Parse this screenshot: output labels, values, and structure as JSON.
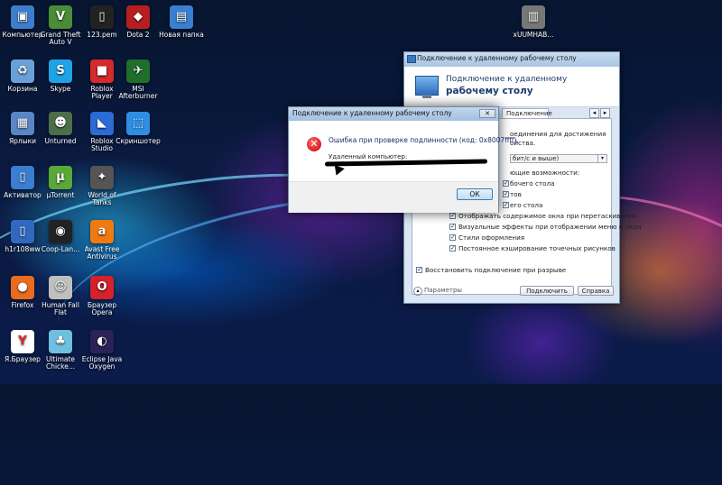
{
  "desktop": {
    "icons": [
      {
        "label": "Компьютер",
        "icon": "computer-icon",
        "color": "#3d7ecb"
      },
      {
        "label": "Grand Theft Auto V",
        "icon": "gta-icon",
        "color": "#4a8c3a"
      },
      {
        "label": "123.pem",
        "icon": "file-icon",
        "color": "#222222"
      },
      {
        "label": "Dota 2",
        "icon": "dota-icon",
        "color": "#b51f1f"
      },
      {
        "label": "Новая папка",
        "icon": "folder-icon",
        "color": "#3a7fd0"
      },
      {
        "label": "Корзина",
        "icon": "recycle-bin-icon",
        "color": "#6aa0d8"
      },
      {
        "label": "Skype",
        "icon": "skype-icon",
        "color": "#1fa3e6"
      },
      {
        "label": "Roblox Player",
        "icon": "roblox-icon",
        "color": "#d42a2a"
      },
      {
        "label": "MSI Afterburner",
        "icon": "msi-icon",
        "color": "#1f6e2c"
      },
      {
        "label": "Ярлыки",
        "icon": "shortcuts-icon",
        "color": "#5a86c5"
      },
      {
        "label": "Unturned",
        "icon": "unturned-icon",
        "color": "#4c6f4a"
      },
      {
        "label": "Roblox Studio",
        "icon": "roblox-studio-icon",
        "color": "#2a6bd4"
      },
      {
        "label": "Скриншотер",
        "icon": "screenshot-icon",
        "color": "#2f8de4"
      },
      {
        "label": "Активатор",
        "icon": "activator-icon",
        "color": "#3b7dd0"
      },
      {
        "label": "µTorrent",
        "icon": "utorrent-icon",
        "color": "#5aa83a"
      },
      {
        "label": "World of Tanks",
        "icon": "wot-icon",
        "color": "#555555"
      },
      {
        "label": "h1r108ww",
        "icon": "file-icon",
        "color": "#2f6ac0"
      },
      {
        "label": "Coop-Lan...",
        "icon": "cooplan-icon",
        "color": "#222222"
      },
      {
        "label": "Avast Free Antivirus",
        "icon": "avast-icon",
        "color": "#f07a12"
      },
      {
        "label": "Firefox",
        "icon": "firefox-icon",
        "color": "#e86b1f"
      },
      {
        "label": "Human Fall Flat",
        "icon": "humanfallflat-icon",
        "color": "#bfbfbf"
      },
      {
        "label": "Браузер Opera",
        "icon": "opera-icon",
        "color": "#d3222b"
      },
      {
        "label": "Я.Браузер",
        "icon": "yandex-icon",
        "color": "#ffffff"
      },
      {
        "label": "Ultimate Chicke...",
        "icon": "chicken-icon",
        "color": "#6fbfe0"
      },
      {
        "label": "Eclipse Java Oxygen",
        "icon": "eclipse-icon",
        "color": "#2c2255"
      },
      {
        "label": "xUUMHAB...",
        "icon": "image-icon",
        "color": "#777777"
      }
    ]
  },
  "rdp": {
    "title": "Подключение к удаленному рабочему столу",
    "header_line1": "Подключение к удаленному",
    "header_line2": "рабочему столу",
    "tab_visible": "Подключение",
    "text_1": "оединения для достижения",
    "text_2": "ойства.",
    "select_value": "бит/с и выше)",
    "text_3": "ющие возможности:",
    "option_1": "бочего стола",
    "option_2": "тов",
    "option_3": "его стола",
    "checks": [
      "Отображать содержимое окна при перетаскивании",
      "Визуальные эффекты при отображении меню и окон",
      "Стили оформления",
      "Постоянное кэширование точечных рисунков"
    ],
    "reconnect": "Восстановить подключение при разрыве",
    "params": "Параметры",
    "connect": "Подключить",
    "help": "Справка"
  },
  "error": {
    "title": "Подключение к удаленному рабочему столу",
    "message": "Ошибка при проверке подлинности (код: 0x8007ffff).",
    "remote_label": "Удаленный компьютер:",
    "ok": "ОК",
    "close_glyph": "✕"
  }
}
